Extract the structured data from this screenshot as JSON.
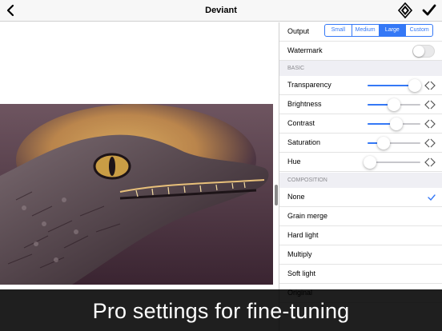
{
  "app": {
    "title": "Deviant"
  },
  "toolbar": {
    "back_icon": "chevron-left-icon",
    "logo_icon": "deviant-logo-icon",
    "confirm_icon": "checkmark-icon"
  },
  "colors": {
    "accent": "#3478f6",
    "section_bg": "#efeff4",
    "caption_bg": "#000000"
  },
  "output": {
    "label": "Output",
    "options": [
      "Small",
      "Medium",
      "Large",
      "Custom"
    ],
    "selected": "Large"
  },
  "watermark": {
    "label": "Watermark",
    "enabled": false
  },
  "basic": {
    "header": "BASIC",
    "sliders": [
      {
        "label": "Transparency",
        "value": 0.9
      },
      {
        "label": "Brightness",
        "value": 0.5
      },
      {
        "label": "Contrast",
        "value": 0.55
      },
      {
        "label": "Saturation",
        "value": 0.3
      },
      {
        "label": "Hue",
        "value": 0.05
      }
    ]
  },
  "composition": {
    "header": "COMPOSITION",
    "items": [
      "None",
      "Grain merge",
      "Hard light",
      "Multiply",
      "Soft light",
      "Original"
    ],
    "selected": "None"
  },
  "caption": {
    "text": "Pro settings for fine-tuning"
  }
}
